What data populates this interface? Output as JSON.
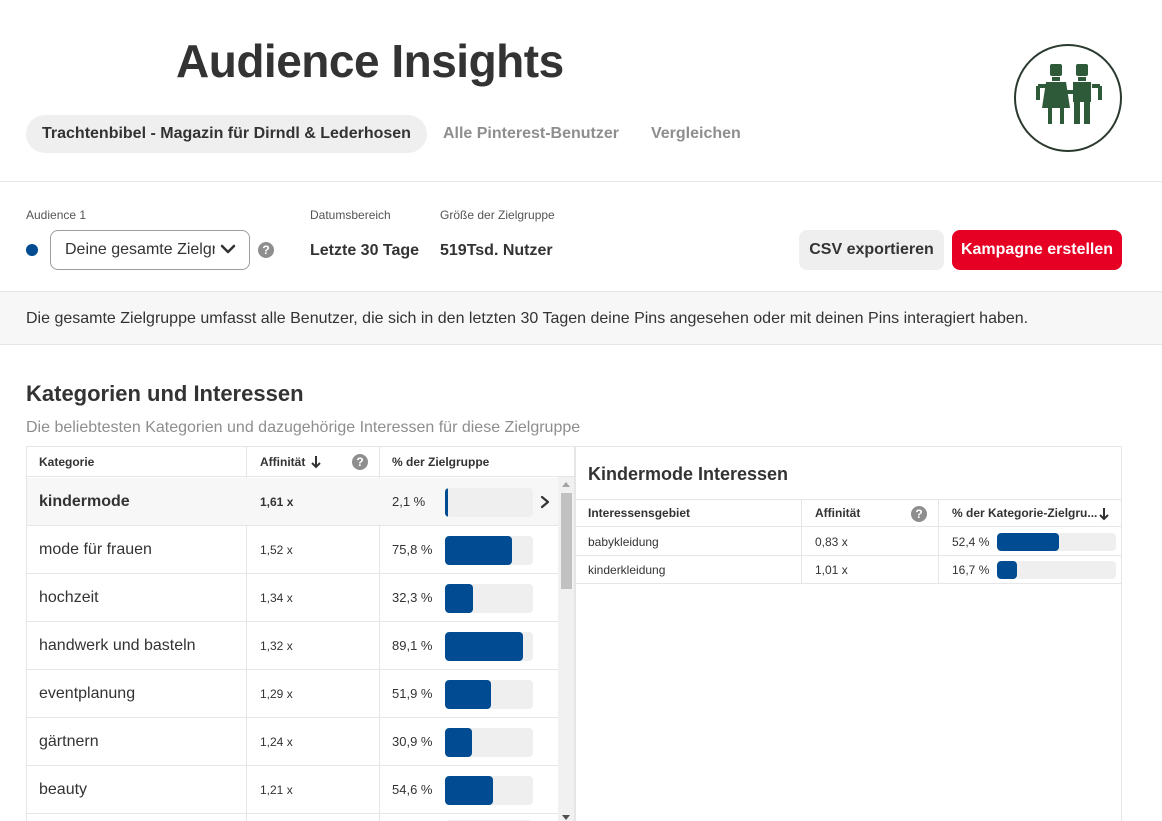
{
  "header": {
    "title": "Audience Insights",
    "tabs": [
      {
        "label": "Trachtenbibel - Magazin für Dirndl & Lederhosen",
        "active": true
      },
      {
        "label": "Alle Pinterest-Benutzer",
        "active": false
      },
      {
        "label": "Vergleichen",
        "active": false
      }
    ]
  },
  "controls": {
    "audience_label": "Audience 1",
    "audience_value": "Deine gesamte Zielgruppe",
    "date_label": "Datumsbereich",
    "date_value": "Letzte 30 Tage",
    "size_label": "Größe der Zielgruppe",
    "size_value": "519Tsd. Nutzer",
    "export_label": "CSV exportieren",
    "campaign_label": "Kampagne erstellen",
    "help_glyph": "?"
  },
  "info_text": "Die gesamte Zielgruppe umfasst alle Benutzer, die sich in den letzten 30 Tagen deine Pins angesehen oder mit deinen Pins interagiert haben.",
  "section": {
    "title": "Kategorien und Interessen",
    "subtitle": "Die beliebtesten Kategorien und dazugehörige Interessen für diese Zielgruppe"
  },
  "categories_table": {
    "headers": {
      "category": "Kategorie",
      "affinity": "Affinität",
      "percent": "% der Zielgruppe"
    },
    "rows": [
      {
        "category": "kindermode",
        "affinity": "1,61 x",
        "percent": "2,1 %",
        "share": 0.021,
        "selected": true
      },
      {
        "category": "mode für frauen",
        "affinity": "1,52 x",
        "percent": "75,8 %",
        "share": 0.758
      },
      {
        "category": "hochzeit",
        "affinity": "1,34 x",
        "percent": "32,3 %",
        "share": 0.323
      },
      {
        "category": "handwerk und basteln",
        "affinity": "1,32 x",
        "percent": "89,1 %",
        "share": 0.891
      },
      {
        "category": "eventplanung",
        "affinity": "1,29 x",
        "percent": "51,9 %",
        "share": 0.519
      },
      {
        "category": "gärtnern",
        "affinity": "1,24 x",
        "percent": "30,9 %",
        "share": 0.309
      },
      {
        "category": "beauty",
        "affinity": "1,21 x",
        "percent": "54,6 %",
        "share": 0.546
      }
    ]
  },
  "interests_panel": {
    "title": "Kindermode Interessen",
    "headers": {
      "interest": "Interessensgebiet",
      "affinity": "Affinität",
      "percent": "% der Kategorie-Zielgru..."
    },
    "rows": [
      {
        "interest": "babykleidung",
        "affinity": "0,83 x",
        "percent": "52,4 %",
        "share": 0.524
      },
      {
        "interest": "kinderkleidung",
        "affinity": "1,01 x",
        "percent": "16,7 %",
        "share": 0.167
      }
    ]
  },
  "colors": {
    "accent_blue": "#004b91",
    "brand_red": "#e60023",
    "dot": "#004b91"
  },
  "icons": [
    "chevron-down-icon",
    "help-icon",
    "sort-down-icon",
    "chevron-right-icon",
    "avatar-logo"
  ]
}
